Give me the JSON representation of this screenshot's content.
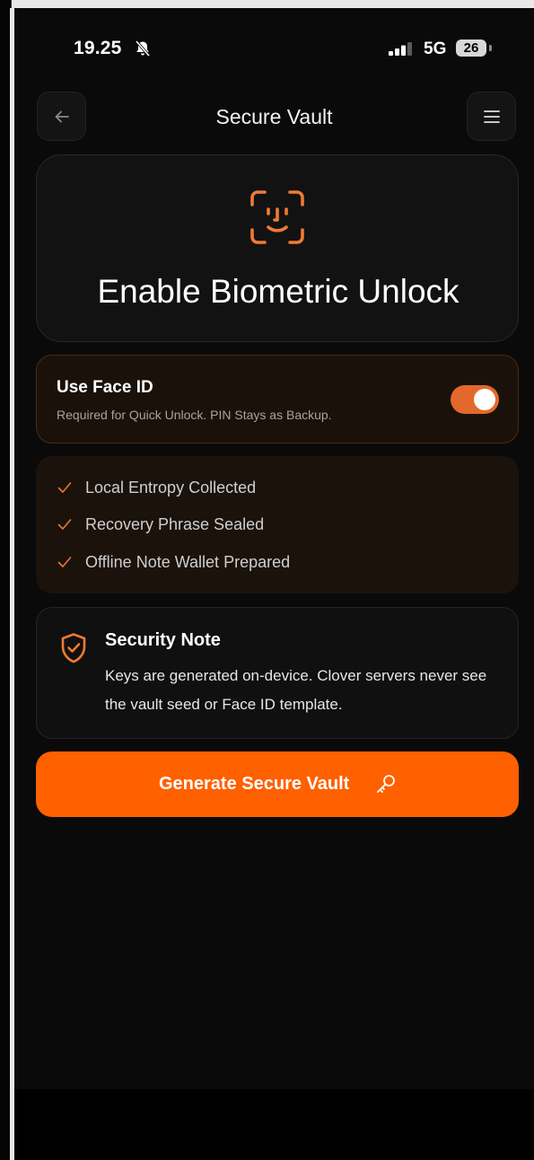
{
  "status_bar": {
    "time": "19.25",
    "network": "5G",
    "battery": "26"
  },
  "header": {
    "title": "Secure Vault"
  },
  "biometric": {
    "title": "Enable Biometric Unlock"
  },
  "face_id_toggle": {
    "title": "Use Face ID",
    "subtitle": "Required for Quick Unlock. PIN Stays as Backup.",
    "enabled": true
  },
  "checklist": [
    {
      "label": "Local Entropy Collected"
    },
    {
      "label": "Recovery Phrase Sealed"
    },
    {
      "label": "Offline Note Wallet Prepared"
    }
  ],
  "security_note": {
    "title": "Security Note",
    "body": "Keys are generated on-device. Clover servers never see the vault seed or Face ID template."
  },
  "cta": {
    "label": "Generate Secure Vault"
  },
  "colors": {
    "accent": "#ff6000",
    "icon_orange": "#f07a32",
    "background": "#0a0a0a"
  }
}
